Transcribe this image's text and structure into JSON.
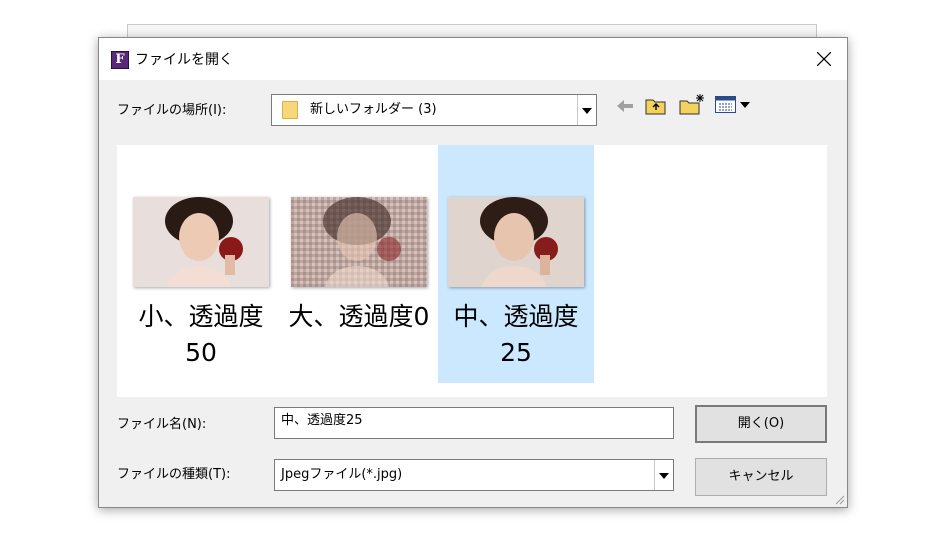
{
  "dialog": {
    "title": "ファイルを開く",
    "app_icon_letter": "F"
  },
  "location": {
    "label": "ファイルの場所(I):",
    "value": "新しいフォルダー (3)"
  },
  "toolbar": {
    "icons": [
      "back-arrow-icon",
      "up-folder-icon",
      "new-folder-icon",
      "view-menu-icon"
    ]
  },
  "files": [
    {
      "name": "小、透過度\n50",
      "selected": false
    },
    {
      "name": "大、透過度0",
      "selected": false
    },
    {
      "name": "中、透過度\n25",
      "selected": true
    }
  ],
  "filename": {
    "label": "ファイル名(N):",
    "value": "中、透過度25"
  },
  "filetype": {
    "label": "ファイルの種類(T):",
    "value": "Jpegファイル(*.jpg)"
  },
  "buttons": {
    "open": "開く(O)",
    "cancel": "キャンセル"
  },
  "colors": {
    "selection": "#cce8ff",
    "dialog_bg": "#f0f0f0"
  }
}
